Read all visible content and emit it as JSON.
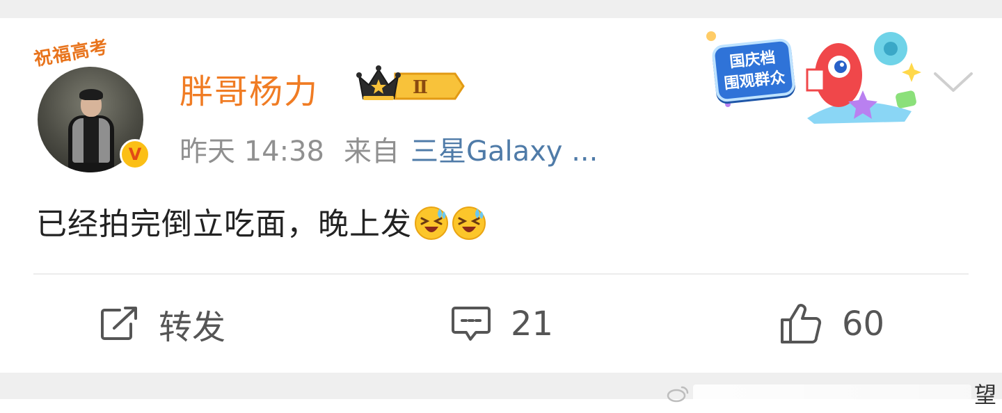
{
  "post": {
    "avatar_banner": "祝福高考",
    "author_name": "胖哥杨力",
    "vip_level": "Ⅱ",
    "time": "昨天 14:38",
    "source_label": "来自",
    "source": "三星Galaxy ...",
    "festival_badge": {
      "line1": "国庆档",
      "line2": "围观群众"
    },
    "text": "已经拍完倒立吃面，晚上发",
    "emojis": [
      "laugh-cry-emoji",
      "laugh-cry-emoji"
    ]
  },
  "actions": {
    "repost_label": "转发",
    "comment_count": "21",
    "like_count": "60"
  },
  "watermark": {
    "char": "望"
  },
  "colors": {
    "username": "#f07c24",
    "source_link": "#4f7ba8",
    "meta": "#909090",
    "text": "#222222",
    "background": "#efefef"
  }
}
